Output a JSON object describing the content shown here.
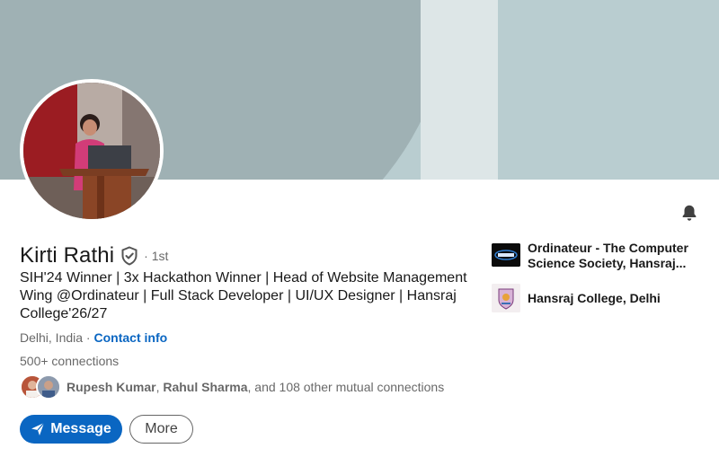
{
  "profile": {
    "name": "Kirti Rathi",
    "degree": "· 1st",
    "headline": "SIH'24 Winner | 3x Hackathon Winner | Head of Website Management Wing @Ordinateur | Full Stack Developer | UI/UX Designer | Hansraj College'26/27",
    "location": "Delhi, India",
    "location_separator": " · ",
    "contact_info": "Contact info",
    "connections_count": "500+",
    "connections_label": " connections",
    "mutual": {
      "name1": "Rupesh Kumar",
      "separator": ", ",
      "name2": "Rahul Sharma",
      "rest": ", and 108 other mutual connections"
    }
  },
  "actions": {
    "message": "Message",
    "more": "More"
  },
  "side": {
    "items": [
      {
        "label": "Ordinateur - The Computer Science Society, Hansraj...",
        "logo": "ordinateur-logo"
      },
      {
        "label": "Hansraj College, Delhi",
        "logo": "hansraj-college-logo"
      }
    ]
  },
  "icons": {
    "verified": "verified-shield-icon",
    "bell": "bell-icon",
    "send": "send-icon"
  },
  "colors": {
    "accent": "#0a66c2",
    "banner": "#b9cdd0",
    "banner_dark": "#9fb1b4"
  }
}
